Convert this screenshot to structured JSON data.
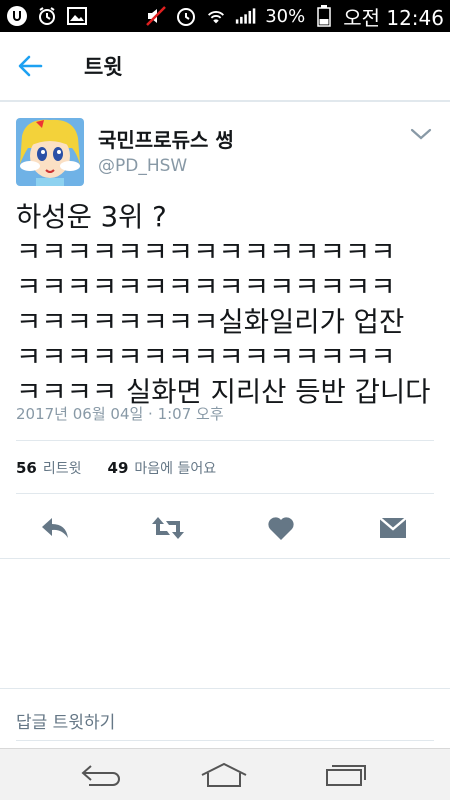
{
  "status_bar": {
    "battery_pct": "30%",
    "time": "오전 12:46",
    "icons_left": [
      "notification-u-icon",
      "alarm-icon",
      "image-icon"
    ],
    "icons_right": [
      "mute-icon",
      "alarm-clock-icon",
      "wifi-icon",
      "signal-icon",
      "battery-icon"
    ]
  },
  "header": {
    "title": "트윗",
    "back_icon": "back-arrow-icon"
  },
  "tweet": {
    "author_name": "국민프로듀스 썽",
    "author_handle": "@PD_HSW",
    "text": "하성운 3위 ?\nㅋㅋㅋㅋㅋㅋㅋㅋㅋㅋㅋㅋㅋㅋㅋ\nㅋㅋㅋㅋㅋㅋㅋㅋㅋㅋㅋㅋㅋㅋㅋ\nㅋㅋㅋㅋㅋㅋㅋㅋ실화일리가 업잔\nㅋㅋㅋㅋㅋㅋㅋㅋㅋㅋㅋㅋㅋㅋㅋ\nㅋㅋㅋㅋ 실화면 지리산 등반 갑니다",
    "timestamp": "2017년 06월 04일 · 1:07 오후",
    "retweet_count": "56",
    "retweet_label": "리트윗",
    "like_count": "49",
    "like_label": "마음에 들어요"
  },
  "actions": [
    "reply-icon",
    "retweet-icon",
    "like-heart-icon",
    "direct-message-icon"
  ],
  "reply": {
    "placeholder": "답글 트윗하기"
  },
  "nav": [
    "back-nav-icon",
    "home-nav-icon",
    "recents-nav-icon"
  ],
  "colors": {
    "accent": "#1da1f2",
    "muted": "#8899a6",
    "icon_gray": "#657786"
  }
}
